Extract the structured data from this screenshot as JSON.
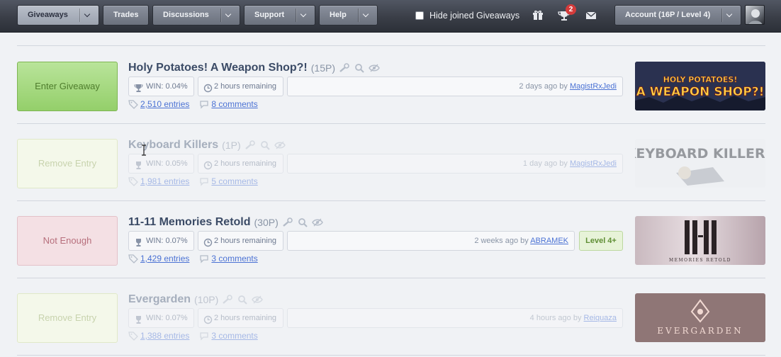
{
  "nav": {
    "items": [
      {
        "label": "Giveaways",
        "active": true
      },
      {
        "label": "Trades",
        "active": false
      },
      {
        "label": "Discussions",
        "active": false
      },
      {
        "label": "Support",
        "active": false
      },
      {
        "label": "Help",
        "active": false
      }
    ],
    "hide_joined_label": "Hide joined Giveaways",
    "hide_joined_checked": false,
    "won_badge": "2",
    "account_label": "Account (16P / Level 4)",
    "icons": [
      "gift-icon",
      "trophy-icon",
      "envelope-icon"
    ]
  },
  "giveaways": [
    {
      "action": "Enter Giveaway",
      "name": "Holy Potatoes! A Weapon Shop?!",
      "points": "(15P)",
      "win": "WIN: 0.04%",
      "remaining": "2 hours remaining",
      "created_prefix": "2 days ago by",
      "creator": "MagistRxJedi",
      "entries": "2,510 entries",
      "comments": "8 comments",
      "thumb_text": "HOLY POTATOES! A WEAPON SHOP?!"
    },
    {
      "action": "Remove Entry",
      "name": "Keyboard Killers",
      "points": "(1P)",
      "win": "WIN: 0.05%",
      "remaining": "2 hours remaining",
      "created_prefix": "1 day ago by",
      "creator": "MagistRxJedi",
      "entries": "1,981 entries",
      "comments": "5 comments",
      "thumb_text": "KEYBOARD KILLERS"
    },
    {
      "action": "Not Enough",
      "name": "11-11 Memories Retold",
      "points": "(30P)",
      "win": "WIN: 0.07%",
      "remaining": "2 hours remaining",
      "created_prefix": "2 weeks ago by",
      "creator": "ABRAMEK",
      "level": "Level 4+",
      "entries": "1,429 entries",
      "comments": "3 comments",
      "thumb_text": "MEMORIES RETOLD"
    },
    {
      "action": "Remove Entry",
      "name": "Evergarden",
      "points": "(10P)",
      "win": "WIN: 0.07%",
      "remaining": "2 hours remaining",
      "created_prefix": "4 hours ago by",
      "creator": "Reiquaza",
      "entries": "1,388 entries",
      "comments": "3 comments",
      "thumb_text": "EVERGARDEN"
    }
  ]
}
